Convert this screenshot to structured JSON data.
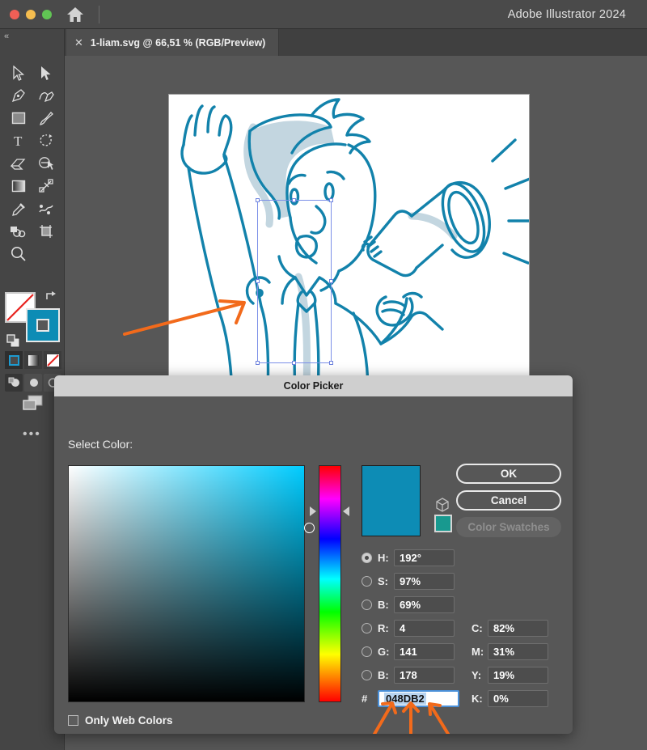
{
  "window": {
    "app_title": "Adobe Illustrator 2024",
    "home_icon": "home-icon",
    "traffic_lights": [
      "close",
      "minimize",
      "maximize"
    ]
  },
  "tab": {
    "close_label": "✕",
    "label": "1-liam.svg @ 66,51 % (RGB/Preview)"
  },
  "toolbar": {
    "collapse_label": "«",
    "tools": [
      {
        "name": "selection-tool",
        "icon": "arrow-cursor-icon"
      },
      {
        "name": "direct-selection-tool",
        "icon": "filled-arrow-cursor-icon"
      },
      {
        "name": "pen-tool",
        "icon": "pen-nib-icon"
      },
      {
        "name": "curvature-tool",
        "icon": "curvature-pen-icon"
      },
      {
        "name": "rectangle-tool",
        "icon": "rectangle-icon"
      },
      {
        "name": "paintbrush-tool",
        "icon": "paintbrush-icon"
      },
      {
        "name": "type-tool",
        "icon": "type-t-icon"
      },
      {
        "name": "rotate-tool",
        "icon": "rotate-arrow-icon"
      },
      {
        "name": "eraser-tool",
        "icon": "eraser-icon"
      },
      {
        "name": "shape-builder-tool",
        "icon": "shape-builder-icon"
      },
      {
        "name": "gradient-tool",
        "icon": "gradient-square-icon"
      },
      {
        "name": "free-transform-tool",
        "icon": "free-transform-icon"
      },
      {
        "name": "eyedropper-tool",
        "icon": "eyedropper-icon"
      },
      {
        "name": "symbol-sprayer-tool",
        "icon": "symbol-sprayer-icon"
      },
      {
        "name": "artboard-tool",
        "icon": "overlapping-shapes-icon"
      },
      {
        "name": "slice-tool",
        "icon": "crop-artboard-icon"
      },
      {
        "name": "zoom-tool",
        "icon": "magnifier-icon"
      }
    ],
    "fill_color": "#0d8cb5",
    "stroke_color": "#ffffff",
    "swap_icon": "swap-fill-stroke-icon",
    "default_icon": "default-fill-stroke-icon",
    "mode_buttons": [
      "color-mode",
      "gradient-mode",
      "none-mode"
    ],
    "draw_buttons": [
      "draw-normal",
      "draw-behind",
      "draw-inside"
    ],
    "screen_mode_icon": "screen-mode-icon",
    "more_tools_label": "•••"
  },
  "canvas": {
    "artwork_name": "cartoon-man-with-megaphone",
    "line_color": "#1282ab",
    "shadow_color": "#c3d6e0",
    "selection_border_color": "#7b8fe8",
    "annotation_color": "#f26a1b"
  },
  "dialog": {
    "title": "Color Picker",
    "select_label": "Select Color:",
    "buttons": {
      "ok": "OK",
      "cancel": "Cancel",
      "color_swatches": "Color Swatches"
    },
    "preview_color": "#0d8cb5",
    "small_swatch_color": "#18998f",
    "cube_icon": "3d-cube-icon",
    "hue_angle_deg": 192,
    "fields": [
      {
        "key": "H",
        "label": "H:",
        "value": "192°",
        "radio": true,
        "name": "hue-field"
      },
      {
        "key": "S",
        "label": "S:",
        "value": "97%",
        "radio": false,
        "name": "saturation-field"
      },
      {
        "key": "B",
        "label": "B:",
        "value": "69%",
        "radio": false,
        "name": "brightness-field"
      },
      {
        "key": "R",
        "label": "R:",
        "value": "4",
        "radio": false,
        "name": "red-field"
      },
      {
        "key": "G",
        "label": "G:",
        "value": "141",
        "radio": false,
        "name": "green-field"
      },
      {
        "key": "B2",
        "label": "B:",
        "value": "178",
        "radio": false,
        "name": "blue-field"
      }
    ],
    "cmyk_fields": [
      {
        "label": "C:",
        "value": "82%",
        "name": "cyan-field"
      },
      {
        "label": "M:",
        "value": "31%",
        "name": "magenta-field"
      },
      {
        "label": "Y:",
        "value": "19%",
        "name": "yellow-field"
      },
      {
        "label": "K:",
        "value": "0%",
        "name": "black-field"
      }
    ],
    "hex": {
      "hash": "#",
      "value": "048DB2"
    },
    "only_web_colors": {
      "label": "Only Web Colors",
      "checked": false
    }
  }
}
